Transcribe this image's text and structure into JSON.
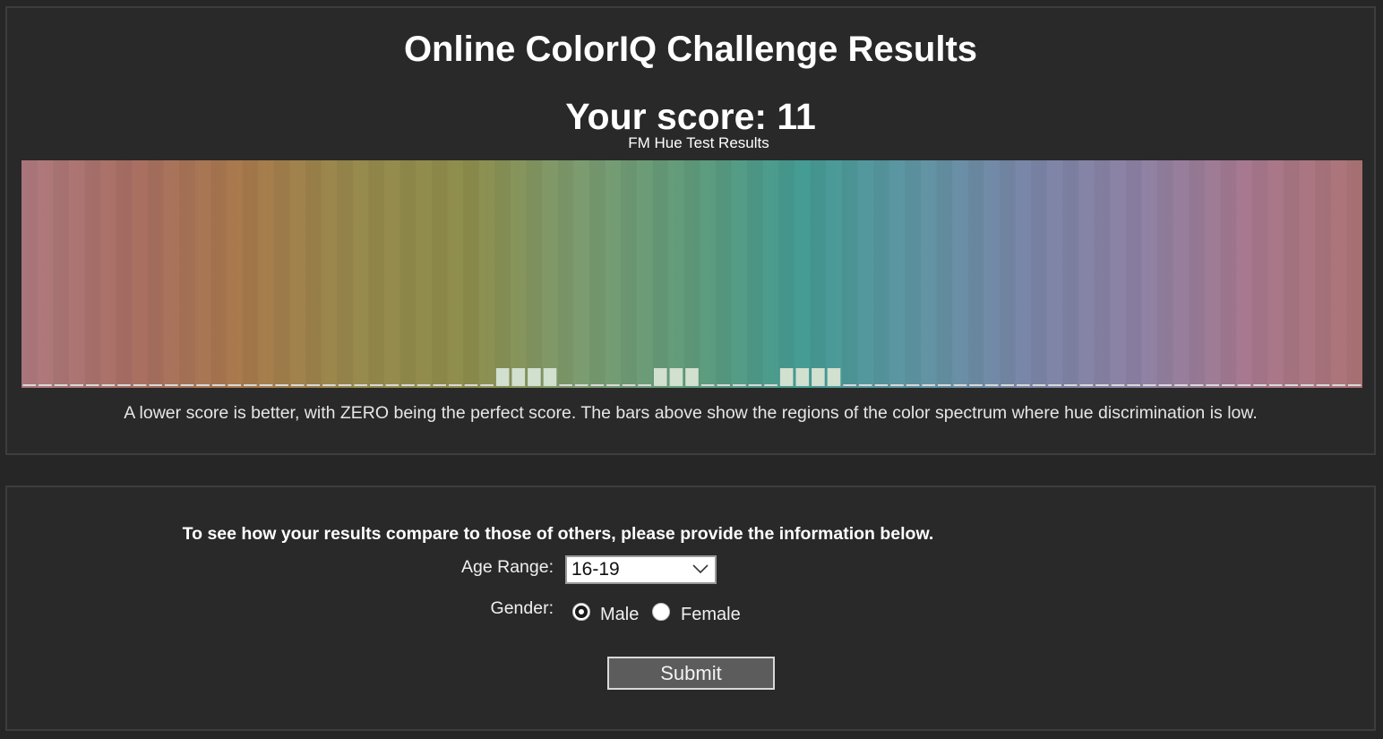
{
  "results": {
    "title": "Online ColorIQ Challenge Results",
    "score_text": "Your score: 11",
    "caption": "A lower score is better, with ZERO being the perfect score. The bars above show the regions of the color spectrum where hue discrimination is low."
  },
  "chart_data": {
    "type": "bar",
    "title": "FM Hue Test Results",
    "xlabel": "",
    "ylabel": "",
    "bin_count": 85,
    "elevated_bins": [
      30,
      31,
      32,
      33,
      40,
      41,
      42,
      48,
      49,
      50,
      51
    ],
    "values": [
      0,
      0,
      0,
      0,
      0,
      0,
      0,
      0,
      0,
      0,
      0,
      0,
      0,
      0,
      0,
      0,
      0,
      0,
      0,
      0,
      0,
      0,
      0,
      0,
      0,
      0,
      0,
      0,
      0,
      0,
      1,
      1,
      1,
      1,
      0,
      0,
      0,
      0,
      0,
      0,
      1,
      1,
      1,
      0,
      0,
      0,
      0,
      0,
      1,
      1,
      1,
      1,
      0,
      0,
      0,
      0,
      0,
      0,
      0,
      0,
      0,
      0,
      0,
      0,
      0,
      0,
      0,
      0,
      0,
      0,
      0,
      0,
      0,
      0,
      0,
      0,
      0,
      0,
      0,
      0,
      0,
      0,
      0,
      0,
      0
    ],
    "ylim": [
      0,
      1
    ],
    "grid": false,
    "spectrum_stops": [
      "#b07a80",
      "#a96f63",
      "#a97a4c",
      "#978a4c",
      "#8e8e4c",
      "#7c9c70",
      "#609c7c",
      "#449c94",
      "#5f95a4",
      "#7a86a8",
      "#8e82a5",
      "#a8788e",
      "#ad7476"
    ],
    "bar_color": "#d2e0d0",
    "baseline_color": "#d9d9d9"
  },
  "compare": {
    "prompt": "To see how your results compare to those of others, please provide the information below.",
    "age_label": "Age Range:",
    "age_value": "16-19",
    "gender_label": "Gender:",
    "gender_options": [
      "Male",
      "Female"
    ],
    "gender_selected": "Male",
    "submit_label": "Submit"
  }
}
